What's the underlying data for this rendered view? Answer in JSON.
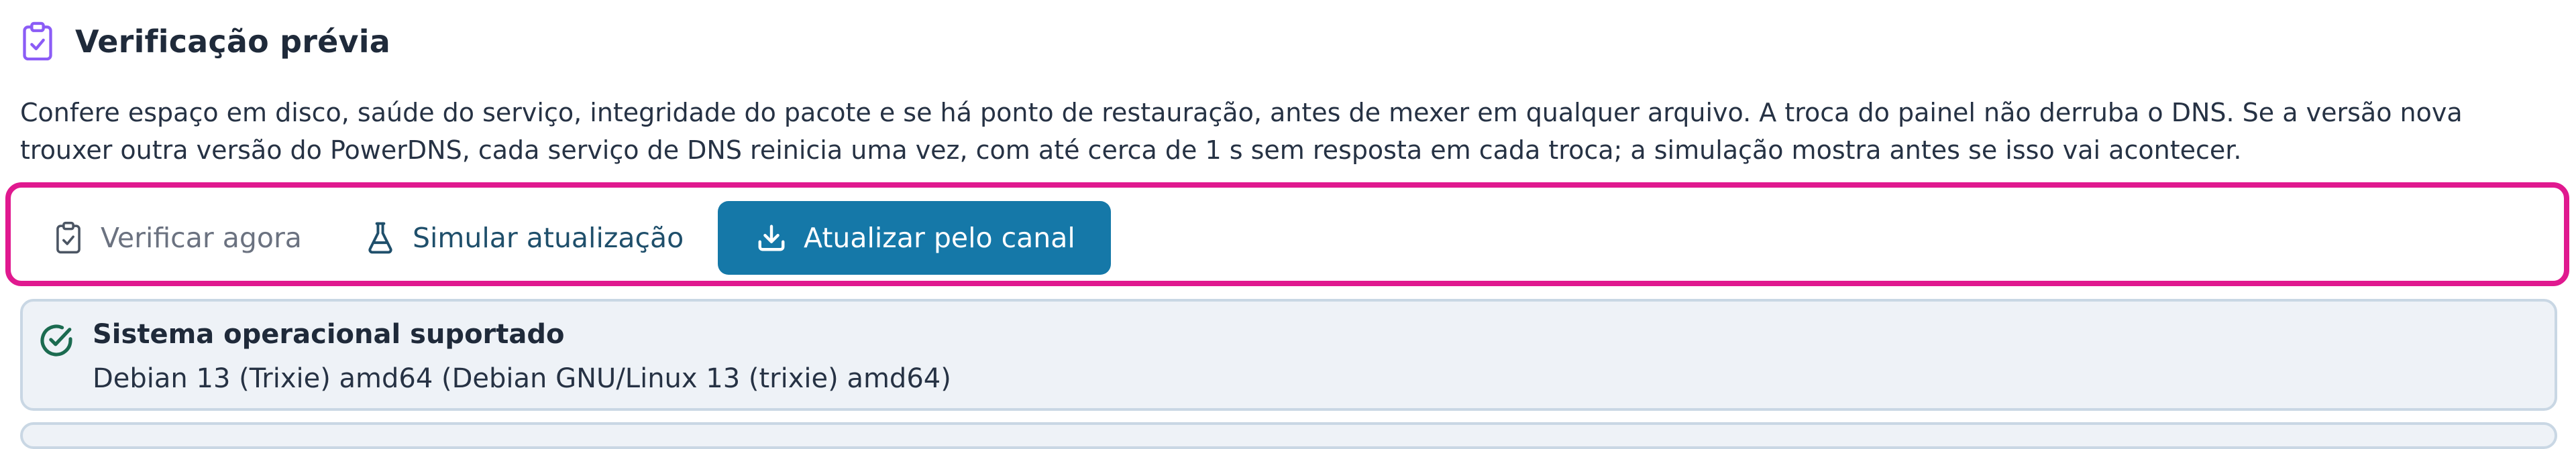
{
  "section": {
    "title": "Verificação prévia",
    "icon": "clipboard-check-icon",
    "description": "Confere espaço em disco, saúde do serviço, integridade do pacote e se há ponto de restauração, antes de mexer em qualquer arquivo. A troca do painel não derruba o DNS. Se a versão nova trouxer outra versão do PowerDNS, cada serviço de DNS reinicia uma vez, com até cerca de 1 s sem resposta em cada troca; a simulação mostra antes se isso vai acontecer."
  },
  "actions": {
    "verify_label": "Verificar agora",
    "verify_icon": "clipboard-check-icon",
    "simulate_label": "Simular atualização",
    "simulate_icon": "flask-icon",
    "update_label": "Atualizar pelo canal",
    "update_icon": "download-icon"
  },
  "checks": [
    {
      "status": "ok",
      "icon": "check-circle-icon",
      "title": "Sistema operacional suportado",
      "detail": "Debian 13 (Trixie) amd64 (Debian GNU/Linux 13 (trixie) amd64)"
    }
  ],
  "colors": {
    "accent": "#1578a8",
    "highlight_border": "#e0198f",
    "success": "#1b6b50",
    "header_icon": "#8b5cf6",
    "card_bg": "#eef2f7",
    "card_border": "#c9d7e4"
  }
}
